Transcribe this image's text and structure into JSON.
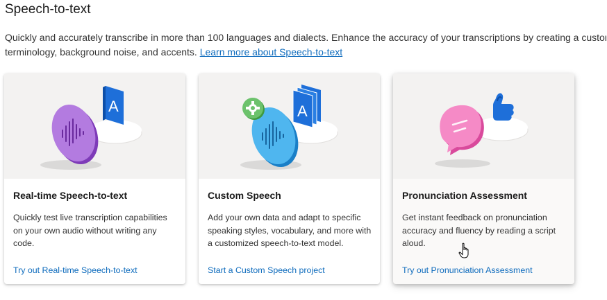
{
  "section": {
    "title": "Speech-to-text",
    "description_line1": "Quickly and accurately transcribe in more than 100 languages and dialects. Enhance the accuracy of your transcriptions by creating a custom",
    "description_line2": "terminology, background noise, and accents. ",
    "learn_more": "Learn more about Speech-to-text"
  },
  "cards": [
    {
      "title": "Real-time Speech-to-text",
      "body": "Quickly test live transcription capabilities on your own audio without writing any code.",
      "link": "Try out Real-time Speech-to-text",
      "icon": "purple-voice-bubble-icon",
      "badge_letter": "A"
    },
    {
      "title": "Custom Speech",
      "body": "Add your own data and adapt to specific speaking styles, vocabulary, and more with a customized speech-to-text model.",
      "link": "Start a Custom Speech project",
      "icon": "blue-voice-bubble-icon",
      "badge_letter": "A"
    },
    {
      "title": "Pronunciation Assessment",
      "body": "Get instant feedback on pronunciation accuracy and fluency by reading a script aloud.",
      "link": "Try out Pronunciation Assessment",
      "icon": "pink-chat-bubble-icon"
    }
  ],
  "colors": {
    "link": "#0f6cbd",
    "art_background": "#f3f2f1",
    "purple": "#9b4fd0",
    "blue": "#2b9be6",
    "pink": "#f06fb8",
    "badge_blue": "#1e6fd9",
    "gear_green": "#5cb85c"
  }
}
